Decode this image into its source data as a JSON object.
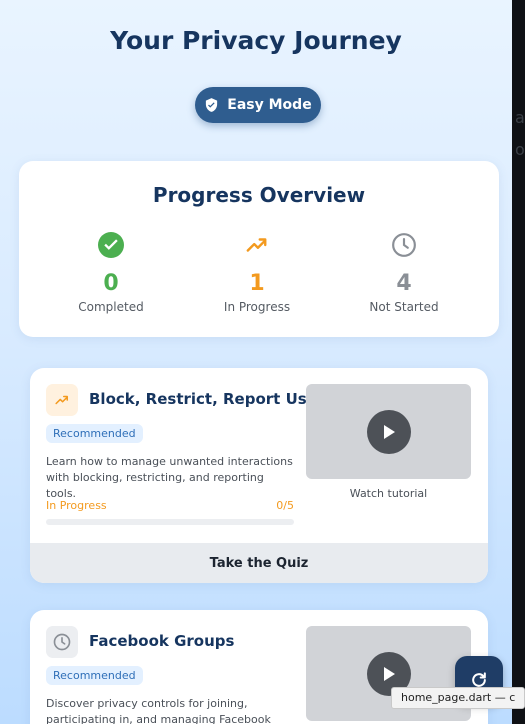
{
  "page": {
    "title": "Your Privacy Journey",
    "mode_label": "Easy Mode"
  },
  "overview": {
    "title": "Progress Overview",
    "stats": [
      {
        "value": "0",
        "label": "Completed",
        "color": "#4caf50",
        "icon": "check-circle-icon"
      },
      {
        "value": "1",
        "label": "In Progress",
        "color": "#f39a1f",
        "icon": "trending-up-icon"
      },
      {
        "value": "4",
        "label": "Not Started",
        "color": "#8a8f96",
        "icon": "clock-icon"
      }
    ]
  },
  "modules": [
    {
      "title": "Block, Restrict, Report Usage",
      "badge": "Recommended",
      "description": "Learn how to manage unwanted interactions with blocking, restricting, and reporting tools.",
      "status": "In Progress",
      "progress_text": "0/5",
      "progress_fraction": 0,
      "video_caption": "Watch tutorial",
      "quiz_label": "Take the Quiz",
      "icon": "trending-up-icon"
    },
    {
      "title": "Facebook Groups",
      "badge": "Recommended",
      "description": "Discover privacy controls for joining, participating in, and managing Facebook groups.",
      "icon": "clock-icon"
    }
  ],
  "tooltip": "home_page.dart — c",
  "colors": {
    "primary": "#16355f",
    "accent_orange": "#f39a1f",
    "success_green": "#4caf50"
  }
}
